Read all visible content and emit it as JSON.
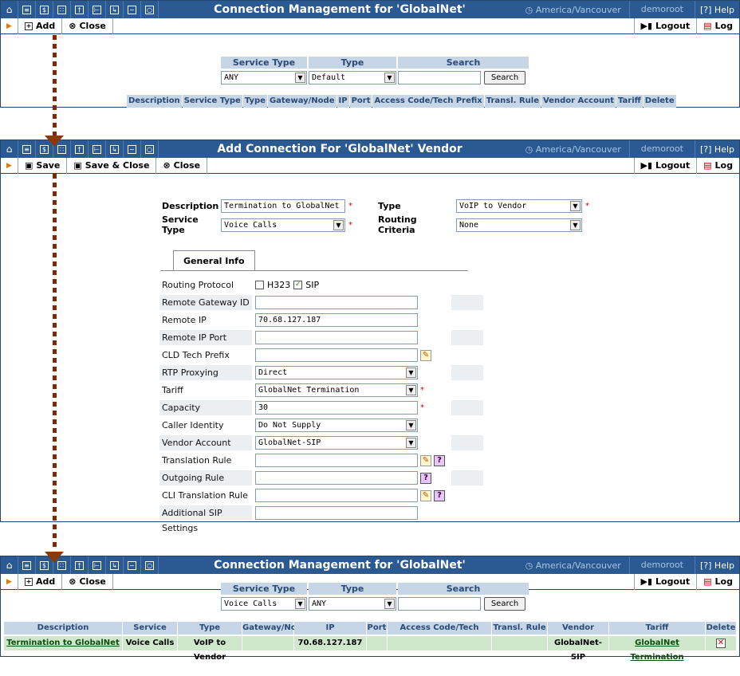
{
  "panel1": {
    "title": "Connection Management for 'GlobalNet'",
    "timezone": "America/Vancouver",
    "user": "demoroot",
    "help": "Help",
    "toolbar": {
      "add": "Add",
      "close": "Close",
      "logout": "Logout",
      "log": "Log"
    },
    "filter": {
      "service_type_label": "Service Type",
      "type_label": "Type",
      "search_label": "Search",
      "service_type_value": "ANY",
      "type_value": "Default",
      "search_value": "",
      "search_button": "Search"
    },
    "columns": [
      "Description",
      "Service Type",
      "Type",
      "Gateway/Node",
      "IP",
      "Port",
      "Access Code/Tech Prefix",
      "Transl. Rule",
      "Vendor Account",
      "Tariff",
      "Delete"
    ]
  },
  "panel2": {
    "title": "Add Connection For 'GlobalNet' Vendor",
    "timezone": "America/Vancouver",
    "user": "demoroot",
    "help": "Help",
    "toolbar": {
      "save": "Save",
      "save_close": "Save & Close",
      "close": "Close",
      "logout": "Logout",
      "log": "Log"
    },
    "form": {
      "description_label": "Description",
      "description_value": "Termination to GlobalNet",
      "type_label": "Type",
      "type_value": "VoIP to Vendor",
      "service_type_label": "Service Type",
      "service_type_value": "Voice Calls",
      "routing_criteria_label": "Routing Criteria",
      "routing_criteria_value": "None"
    },
    "tab": "General Info",
    "fields": {
      "routing_protocol": "Routing Protocol",
      "h323": "H323",
      "sip": "SIP",
      "remote_gateway_id": "Remote Gateway ID",
      "remote_gateway_id_value": "",
      "remote_ip": "Remote IP",
      "remote_ip_value": "70.68.127.187",
      "remote_ip_port": "Remote IP Port",
      "remote_ip_port_value": "",
      "cld_tech_prefix": "CLD Tech Prefix",
      "cld_tech_prefix_value": "",
      "rtp_proxying": "RTP Proxying",
      "rtp_proxying_value": "Direct",
      "tariff": "Tariff",
      "tariff_value": "GlobalNet Termination",
      "capacity": "Capacity",
      "capacity_value": "30",
      "caller_identity": "Caller Identity",
      "caller_identity_value": "Do Not Supply",
      "vendor_account": "Vendor Account",
      "vendor_account_value": "GlobalNet-SIP",
      "translation_rule": "Translation Rule",
      "translation_rule_value": "",
      "outgoing_rule": "Outgoing Rule",
      "outgoing_rule_value": "",
      "cli_translation_rule": "CLI Translation Rule",
      "cli_translation_rule_value": "",
      "additional_sip_settings": "Additional SIP Settings",
      "additional_sip_settings_value": ""
    }
  },
  "panel3": {
    "title": "Connection Management for 'GlobalNet'",
    "timezone": "America/Vancouver",
    "user": "demoroot",
    "help": "Help",
    "toolbar": {
      "add": "Add",
      "close": "Close",
      "logout": "Logout",
      "log": "Log"
    },
    "filter": {
      "service_type_label": "Service Type",
      "type_label": "Type",
      "search_label": "Search",
      "service_type_value": "Voice Calls",
      "type_value": "ANY",
      "search_value": "",
      "search_button": "Search"
    },
    "columns": [
      "Description",
      "Service Type",
      "Type",
      "Gateway/Node",
      "IP",
      "Port",
      "Access Code/Tech Prefix",
      "Transl. Rule",
      "Vendor Account",
      "Tariff",
      "Delete"
    ],
    "row": {
      "description": "Termination to GlobalNet",
      "service_type": "Voice Calls",
      "type": "VoIP to Vendor",
      "gateway": "",
      "ip": "70.68.127.187",
      "port": "",
      "access_code": "",
      "transl_rule": "",
      "vendor_account": "GlobalNet-SIP",
      "tariff": "GlobalNet Termination"
    }
  },
  "icons": [
    "home-icon",
    "list-icon",
    "dollar-icon",
    "grid-icon",
    "person-icon",
    "tree-icon",
    "export-icon",
    "chart-icon",
    "search-icon"
  ],
  "colors": {
    "titlebar": "#2a5a91",
    "header": "#c7d6e6",
    "result_row": "#cfe8cc",
    "required": "#d00000"
  }
}
